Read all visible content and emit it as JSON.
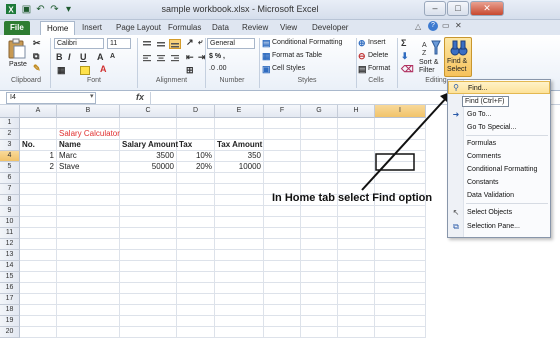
{
  "window": {
    "title": "sample workbook.xlsx - Microsoft Excel"
  },
  "tabs": [
    "Home",
    "Insert",
    "Page Layout",
    "Formulas",
    "Data",
    "Review",
    "View",
    "Developer"
  ],
  "file_tab": "File",
  "ribbon": {
    "clipboard": {
      "label": "Clipboard",
      "paste": "Paste"
    },
    "font": {
      "label": "Font",
      "name": "Calibri",
      "size": "11"
    },
    "alignment": {
      "label": "Alignment"
    },
    "number": {
      "label": "Number",
      "format": "General",
      "symbols": "$  %  ,",
      "decimals": ".0 .00"
    },
    "styles": {
      "label": "Styles",
      "conditional": "Conditional Formatting",
      "format_table": "Format as Table",
      "cell_styles": "Cell Styles"
    },
    "cells": {
      "label": "Cells",
      "insert": "Insert",
      "delete": "Delete",
      "format": "Format"
    },
    "editing": {
      "label": "Editing",
      "sort_filter": "Sort &\nFilter",
      "find_select": "Find &\nSelect"
    }
  },
  "formula_bar": {
    "name_box": "I4",
    "fx": "fx"
  },
  "columns": [
    "A",
    "B",
    "C",
    "D",
    "E",
    "F",
    "G",
    "H",
    "I"
  ],
  "rows": [
    "1",
    "2",
    "3",
    "4",
    "5",
    "6",
    "7",
    "8",
    "9",
    "10",
    "11",
    "12",
    "13",
    "14",
    "15",
    "16",
    "17",
    "18",
    "19",
    "20"
  ],
  "sheet": {
    "title": "Salary Calculator",
    "headers": [
      "No.",
      "Name",
      "Salary Amount",
      "Tax",
      "Tax Amount"
    ],
    "data": [
      [
        "1",
        "Marc",
        "3500",
        "10%",
        "350"
      ],
      [
        "2",
        "Stave",
        "50000",
        "20%",
        "10000"
      ]
    ]
  },
  "menu": {
    "items": [
      "Find...",
      "Go To...",
      "Go To Special...",
      "Formulas",
      "Comments",
      "Conditional Formatting",
      "Constants",
      "Data Validation",
      "Select Objects",
      "Selection Pane..."
    ],
    "tooltip": "Find (Ctrl+F)"
  },
  "annotation": "In Home tab select Find option",
  "colors": {
    "file_tab": "#2f7d32",
    "highlight": "#f6c25b",
    "title_red": "#e03030"
  }
}
